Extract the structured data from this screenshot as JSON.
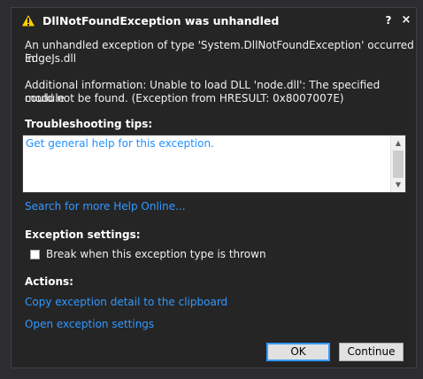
{
  "dialog": {
    "title": "DllNotFoundException was unhandled",
    "help_glyph": "?",
    "close_glyph": "×",
    "icon": "warning-icon"
  },
  "message": {
    "line1": "An unhandled exception of type 'System.DllNotFoundException' occurred in",
    "line2": "EdgeJs.dll",
    "info1": "Additional information: Unable to load DLL 'node.dll': The specified module",
    "info2": "could not be found. (Exception from HRESULT: 0x8007007E)"
  },
  "troubleshooting": {
    "heading": "Troubleshooting tips:",
    "tips": [
      "Get general help for this exception."
    ],
    "search_link": "Search for more Help Online..."
  },
  "exception_settings": {
    "heading": "Exception settings:",
    "checkbox_label": "Break when this exception type is thrown",
    "checked": false
  },
  "actions": {
    "heading": "Actions:",
    "copy_link": "Copy exception detail to the clipboard",
    "open_settings_link": "Open exception settings"
  },
  "buttons": {
    "ok": "OK",
    "continue": "Continue"
  },
  "colors": {
    "background": "#252526",
    "link": "#3399ff",
    "accent_border": "#3399ff",
    "warning_fill": "#ffcc00"
  }
}
